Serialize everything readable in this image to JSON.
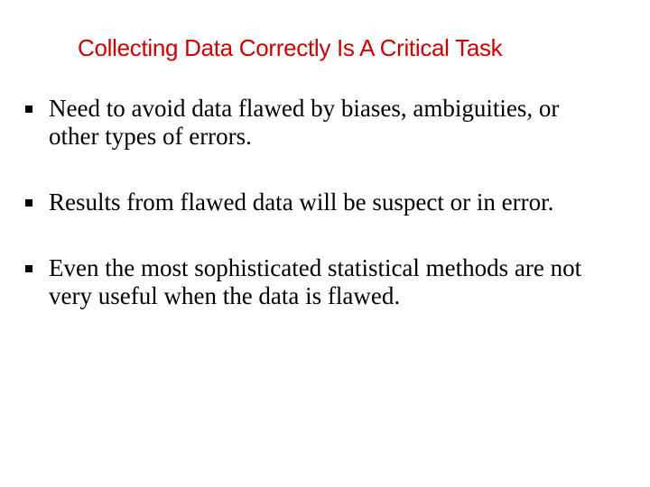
{
  "title": "Collecting Data Correctly Is A Critical Task",
  "bullets": [
    "Need to avoid data flawed by biases, ambiguities, or other types of errors.",
    "Results from flawed data will be suspect or in error.",
    "Even the most sophisticated statistical methods are not very useful when the data is flawed."
  ]
}
